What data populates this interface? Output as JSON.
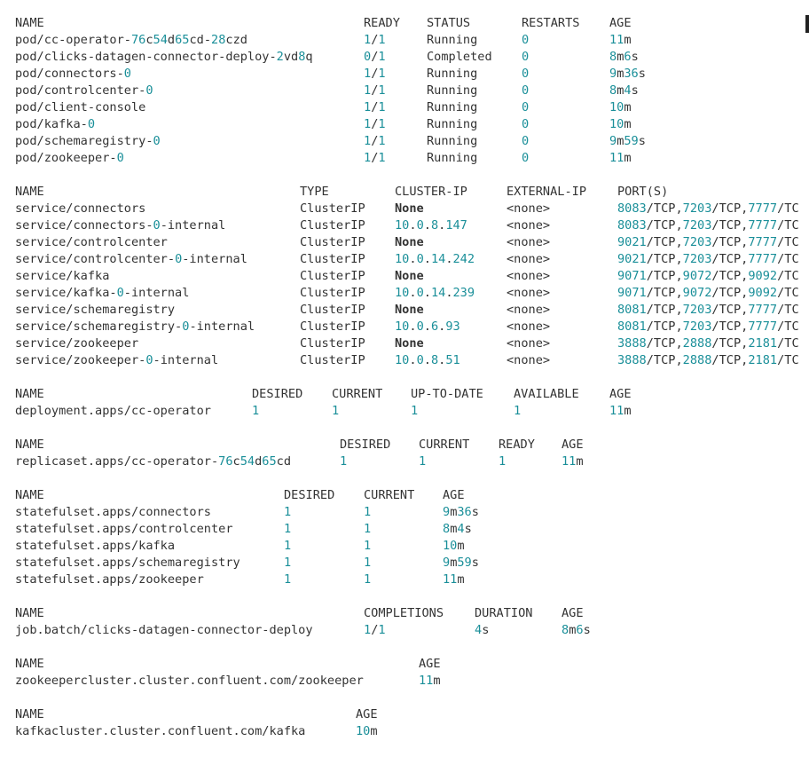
{
  "colors": {
    "text": "#333333",
    "number": "#1a8f99",
    "background": "#ffffff"
  },
  "pods": {
    "headers": [
      "NAME",
      "READY",
      "STATUS",
      "RESTARTS",
      "AGE"
    ],
    "rows": [
      [
        "pod/cc-operator-76c54d65cd-28czd",
        "1/1",
        "Running",
        "0",
        "11m"
      ],
      [
        "pod/clicks-datagen-connector-deploy-2vd8q",
        "0/1",
        "Completed",
        "0",
        "8m6s"
      ],
      [
        "pod/connectors-0",
        "1/1",
        "Running",
        "0",
        "9m36s"
      ],
      [
        "pod/controlcenter-0",
        "1/1",
        "Running",
        "0",
        "8m4s"
      ],
      [
        "pod/client-console",
        "1/1",
        "Running",
        "0",
        "10m"
      ],
      [
        "pod/kafka-0",
        "1/1",
        "Running",
        "0",
        "10m"
      ],
      [
        "pod/schemaregistry-0",
        "1/1",
        "Running",
        "0",
        "9m59s"
      ],
      [
        "pod/zookeeper-0",
        "1/1",
        "Running",
        "0",
        "11m"
      ]
    ]
  },
  "services": {
    "headers": [
      "NAME",
      "TYPE",
      "CLUSTER-IP",
      "EXTERNAL-IP",
      "PORT(S)"
    ],
    "rows": [
      [
        "service/connectors",
        "ClusterIP",
        "None",
        "<none>",
        "8083/TCP,7203/TCP,7777/TC"
      ],
      [
        "service/connectors-0-internal",
        "ClusterIP",
        "10.0.8.147",
        "<none>",
        "8083/TCP,7203/TCP,7777/TC"
      ],
      [
        "service/controlcenter",
        "ClusterIP",
        "None",
        "<none>",
        "9021/TCP,7203/TCP,7777/TC"
      ],
      [
        "service/controlcenter-0-internal",
        "ClusterIP",
        "10.0.14.242",
        "<none>",
        "9021/TCP,7203/TCP,7777/TC"
      ],
      [
        "service/kafka",
        "ClusterIP",
        "None",
        "<none>",
        "9071/TCP,9072/TCP,9092/TC"
      ],
      [
        "service/kafka-0-internal",
        "ClusterIP",
        "10.0.14.239",
        "<none>",
        "9071/TCP,9072/TCP,9092/TC"
      ],
      [
        "service/schemaregistry",
        "ClusterIP",
        "None",
        "<none>",
        "8081/TCP,7203/TCP,7777/TC"
      ],
      [
        "service/schemaregistry-0-internal",
        "ClusterIP",
        "10.0.6.93",
        "<none>",
        "8081/TCP,7203/TCP,7777/TC"
      ],
      [
        "service/zookeeper",
        "ClusterIP",
        "None",
        "<none>",
        "3888/TCP,2888/TCP,2181/TC"
      ],
      [
        "service/zookeeper-0-internal",
        "ClusterIP",
        "10.0.8.51",
        "<none>",
        "3888/TCP,2888/TCP,2181/TC"
      ]
    ]
  },
  "deployments": {
    "headers": [
      "NAME",
      "DESIRED",
      "CURRENT",
      "UP-TO-DATE",
      "AVAILABLE",
      "AGE"
    ],
    "rows": [
      [
        "deployment.apps/cc-operator",
        "1",
        "1",
        "1",
        "1",
        "11m"
      ]
    ]
  },
  "replicasets": {
    "headers": [
      "NAME",
      "DESIRED",
      "CURRENT",
      "READY",
      "AGE"
    ],
    "rows": [
      [
        "replicaset.apps/cc-operator-76c54d65cd",
        "1",
        "1",
        "1",
        "11m"
      ]
    ]
  },
  "statefulsets": {
    "headers": [
      "NAME",
      "DESIRED",
      "CURRENT",
      "AGE"
    ],
    "rows": [
      [
        "statefulset.apps/connectors",
        "1",
        "1",
        "9m36s"
      ],
      [
        "statefulset.apps/controlcenter",
        "1",
        "1",
        "8m4s"
      ],
      [
        "statefulset.apps/kafka",
        "1",
        "1",
        "10m"
      ],
      [
        "statefulset.apps/schemaregistry",
        "1",
        "1",
        "9m59s"
      ],
      [
        "statefulset.apps/zookeeper",
        "1",
        "1",
        "11m"
      ]
    ]
  },
  "jobs": {
    "headers": [
      "NAME",
      "COMPLETIONS",
      "DURATION",
      "AGE"
    ],
    "rows": [
      [
        "job.batch/clicks-datagen-connector-deploy",
        "1/1",
        "4s",
        "8m6s"
      ]
    ]
  },
  "zookeeperclusters": {
    "headers": [
      "NAME",
      "AGE"
    ],
    "rows": [
      [
        "zookeepercluster.cluster.confluent.com/zookeeper",
        "11m"
      ]
    ]
  },
  "kafkaclusters": {
    "headers": [
      "NAME",
      "AGE"
    ],
    "rows": [
      [
        "kafkacluster.cluster.confluent.com/kafka",
        "10m"
      ]
    ]
  }
}
